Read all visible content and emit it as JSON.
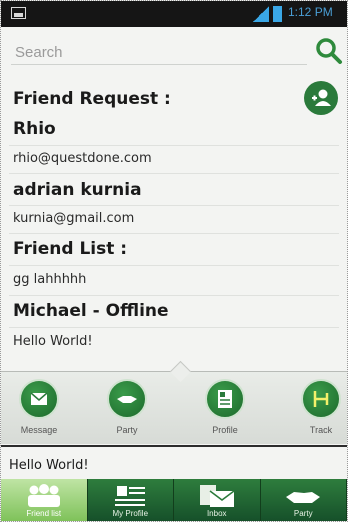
{
  "status_bar": {
    "time": "1:12 PM"
  },
  "search": {
    "placeholder": "Search"
  },
  "friend_requests": {
    "heading": "Friend Request :",
    "items": [
      {
        "name": "Rhio",
        "email": "rhio@questdone.com"
      },
      {
        "name": "adrian kurnia",
        "email": "kurnia@gmail.com"
      }
    ]
  },
  "friend_list": {
    "heading": "Friend List :",
    "items": [
      {
        "name": "gg lahhhhh"
      },
      {
        "name": "Michael - Offline",
        "status": "Hello World!"
      }
    ]
  },
  "actions": [
    {
      "label": "Message",
      "icon": "message-icon"
    },
    {
      "label": "Party",
      "icon": "handshake-icon"
    },
    {
      "label": "Profile",
      "icon": "profile-icon"
    },
    {
      "label": "Track",
      "icon": "track-icon"
    }
  ],
  "status_message": "Hello World!",
  "tabs": [
    {
      "label": "Friend list",
      "icon": "group-icon",
      "active": true
    },
    {
      "label": "My Profile",
      "icon": "profile-card-icon",
      "active": false
    },
    {
      "label": "Inbox",
      "icon": "inbox-icon",
      "active": false
    },
    {
      "label": "Party",
      "icon": "handshake-icon",
      "active": false
    }
  ],
  "colors": {
    "accent_green": "#2a7a3b",
    "status_bar": "#151515",
    "time_blue": "#4a9fd6"
  }
}
